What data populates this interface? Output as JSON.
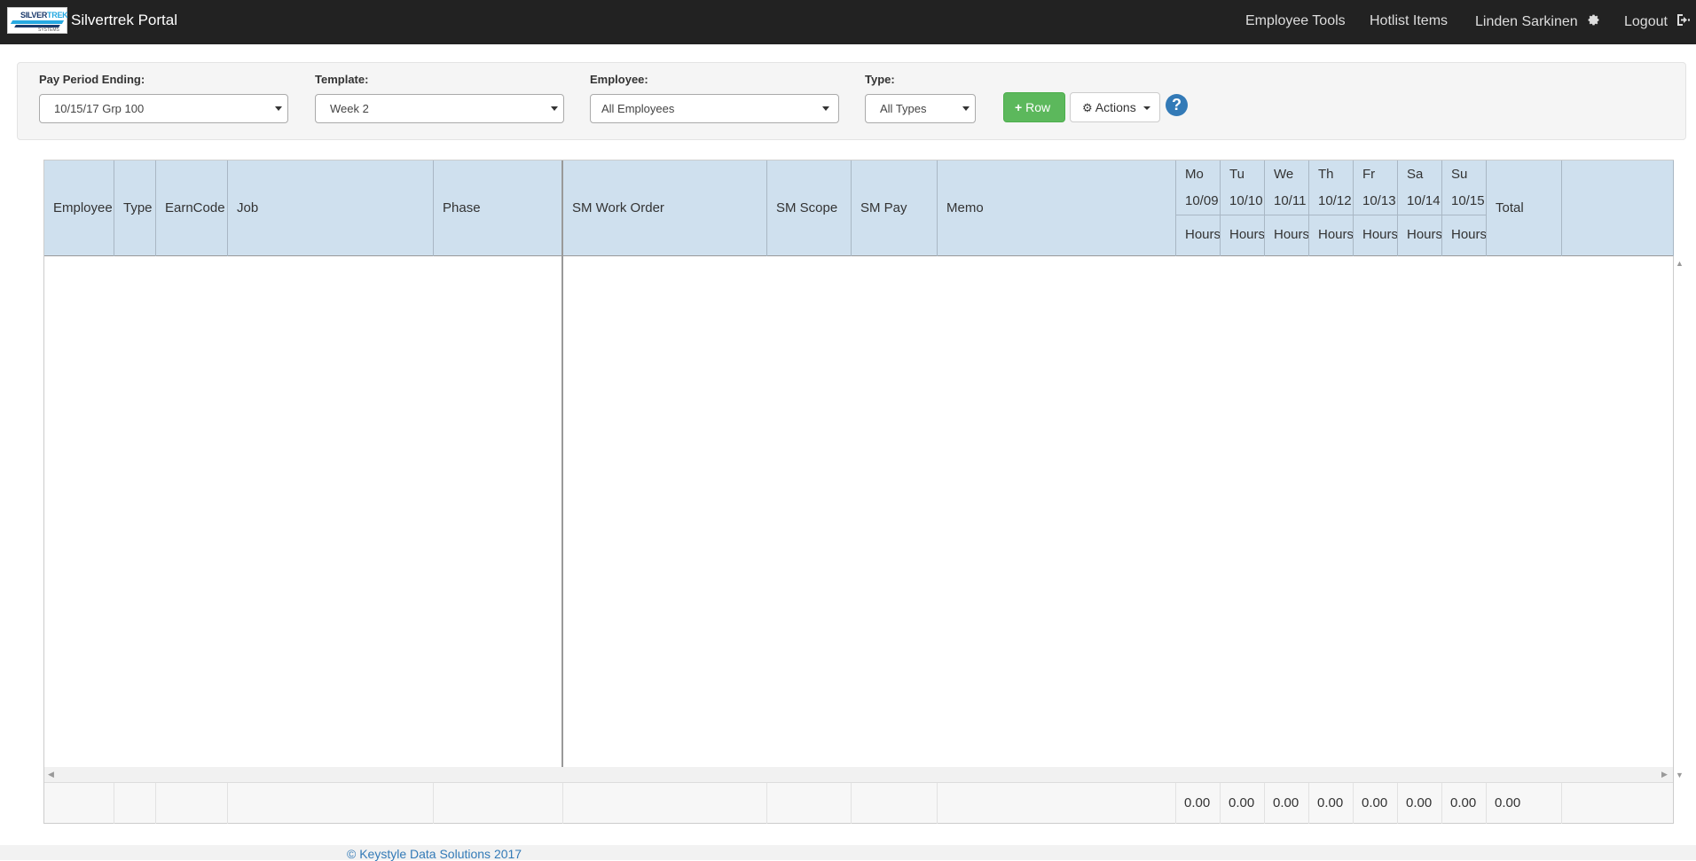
{
  "navbar": {
    "brand": "Silvertrek Portal",
    "logo": {
      "text_a": "SILVER",
      "text_b": "TREK",
      "sub": "SYSTEMS"
    },
    "items": [
      {
        "label": "Employee Tools"
      },
      {
        "label": "Hotlist Items"
      },
      {
        "label": "Linden Sarkinen",
        "icon": "gear-icon"
      },
      {
        "label": "Logout",
        "icon": "logout-icon"
      }
    ]
  },
  "filters": {
    "pay_period": {
      "label": "Pay Period Ending:",
      "value": "10/15/17 Grp 100"
    },
    "template": {
      "label": "Template:",
      "value": "Week 2"
    },
    "employee": {
      "label": "Employee:",
      "value": "All Employees"
    },
    "type": {
      "label": "Type:",
      "value": "All Types"
    },
    "add_row_label": "Row",
    "actions_label": "Actions",
    "help_glyph": "?"
  },
  "grid": {
    "columns": [
      "Employee",
      "Type",
      "EarnCode",
      "Job",
      "Phase",
      "SM Work Order",
      "SM Scope",
      "SM Pay",
      "Memo"
    ],
    "days": [
      {
        "day": "Mo",
        "date": "10/09",
        "unit": "Hours"
      },
      {
        "day": "Tu",
        "date": "10/10",
        "unit": "Hours"
      },
      {
        "day": "We",
        "date": "10/11",
        "unit": "Hours"
      },
      {
        "day": "Th",
        "date": "10/12",
        "unit": "Hours"
      },
      {
        "day": "Fr",
        "date": "10/13",
        "unit": "Hours"
      },
      {
        "day": "Sa",
        "date": "10/14",
        "unit": "Hours"
      },
      {
        "day": "Su",
        "date": "10/15",
        "unit": "Hours"
      }
    ],
    "total_label": "Total",
    "totals": [
      "0.00",
      "0.00",
      "0.00",
      "0.00",
      "0.00",
      "0.00",
      "0.00",
      "0.00"
    ]
  },
  "footer": {
    "copyright": "© Keystyle Data Solutions 2017"
  },
  "colors": {
    "navbar": "#222222",
    "header_bg": "#cfe0ee",
    "add_button": "#5cb85c",
    "link": "#337ab7"
  }
}
